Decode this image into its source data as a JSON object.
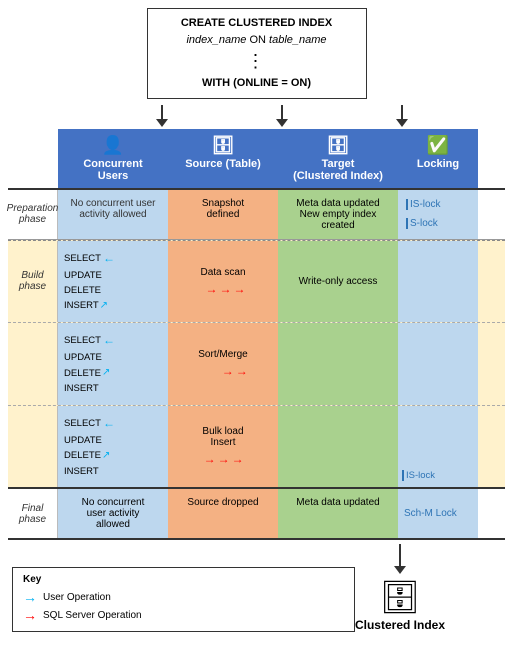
{
  "sql": {
    "line1": "CREATE CLUSTERED INDEX",
    "line2_italic": "index_name",
    "line2_normal": " ON ",
    "line2_italic2": "table_name",
    "line3": "⋮",
    "line4": "WITH (ONLINE = ON)"
  },
  "headers": {
    "concurrent": {
      "icon": "👤",
      "label": "Concurrent\nUsers"
    },
    "source": {
      "icon": "🗄",
      "label": "Source (Table)"
    },
    "target": {
      "icon": "🗄",
      "label": "Target\n(Clustered Index)"
    },
    "locking": {
      "icon": "✅",
      "label": "Locking"
    }
  },
  "preparation": {
    "phase_label": "Preparation\nphase",
    "concurrent": "No concurrent\nuser activity\nallowed",
    "source": "Snapshot\ndefined",
    "target": "Meta data updated\nNew empty index\ncreated",
    "locking": {
      "lock1": "IS-lock",
      "lock2": "S-lock"
    }
  },
  "build": {
    "phase_label": "Build\nphase",
    "rows": [
      {
        "crud": [
          "SELECT",
          "UPDATE",
          "DELETE",
          "INSERT"
        ],
        "source": "Data scan",
        "target": "Write-only access",
        "locking": ""
      },
      {
        "crud": [
          "SELECT",
          "UPDATE",
          "DELETE",
          "INSERT"
        ],
        "source": "Sort/Merge",
        "target": "",
        "locking": ""
      },
      {
        "crud": [
          "SELECT",
          "UPDATE",
          "DELETE",
          "INSERT"
        ],
        "source": "Bulk load\nInsert",
        "target": "",
        "locking": "IS-lock"
      }
    ]
  },
  "final": {
    "phase_label": "Final\nphase",
    "concurrent": "No concurrent\nuser activity\nallowed",
    "source": "Source dropped",
    "target": "Meta data updated",
    "locking": "Sch-M Lock"
  },
  "clustered_index": {
    "icon": "🗄",
    "label": "Clustered Index"
  },
  "key": {
    "title": "Key",
    "items": [
      {
        "color": "cyan",
        "label": "User Operation"
      },
      {
        "color": "red",
        "label": "SQL Server Operation"
      }
    ]
  }
}
